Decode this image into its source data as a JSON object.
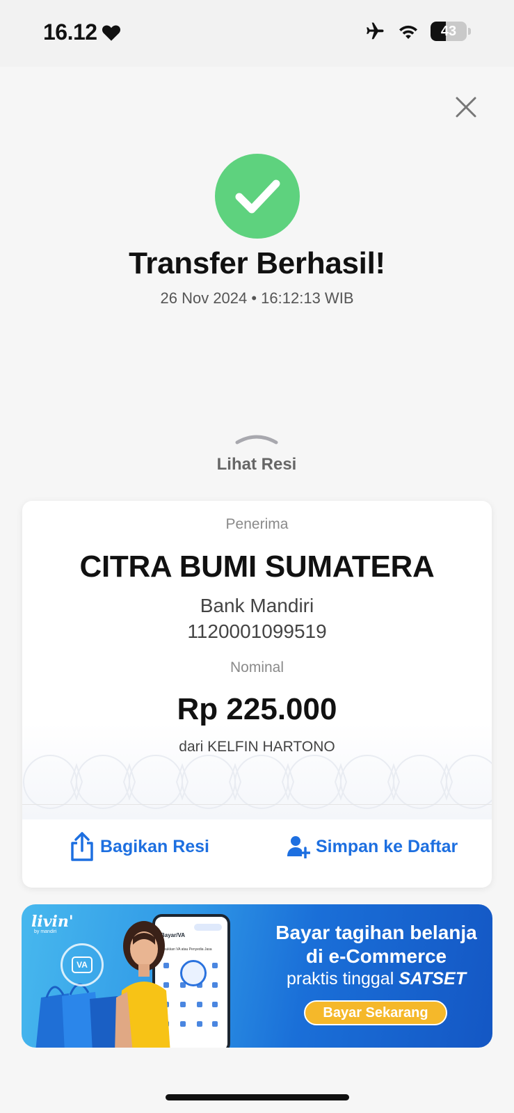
{
  "status_bar": {
    "time": "16.12",
    "battery_level": "43"
  },
  "receipt": {
    "title": "Transfer Berhasil!",
    "datetime": "26 Nov 2024 • 16:12:13 WIB",
    "lihat_resi": "Lihat Resi",
    "recipient_label": "Penerima",
    "recipient_name": "CITRA BUMI SUMATERA",
    "bank_name": "Bank Mandiri",
    "account_number": "1120001099519",
    "amount_label": "Nominal",
    "amount": "Rp 225.000",
    "sender": "dari KELFIN HARTONO",
    "share_label": "Bagikan Resi",
    "save_label": "Simpan ke Daftar"
  },
  "banner": {
    "logo": "livin'",
    "logo_sub": "by mandiri",
    "va_badge": "VA",
    "phone_header": "Bayar/VA",
    "phone_sub": "Masukkan VA atau Penyedia Jasa",
    "headline": "Bayar tagihan belanja di e-Commerce",
    "subline": "praktis tinggal",
    "subline_emphasis": "SATSET",
    "cta": "Bayar Sekarang"
  },
  "colors": {
    "success_green": "#5ed27e",
    "action_blue": "#1d6fe0",
    "cta_yellow": "#f5b82a"
  },
  "icons": [
    "heart-icon",
    "airplane-icon",
    "wifi-icon",
    "battery-icon",
    "close-icon",
    "checkmark-icon",
    "chevron-up-icon",
    "share-icon",
    "add-user-icon"
  ]
}
